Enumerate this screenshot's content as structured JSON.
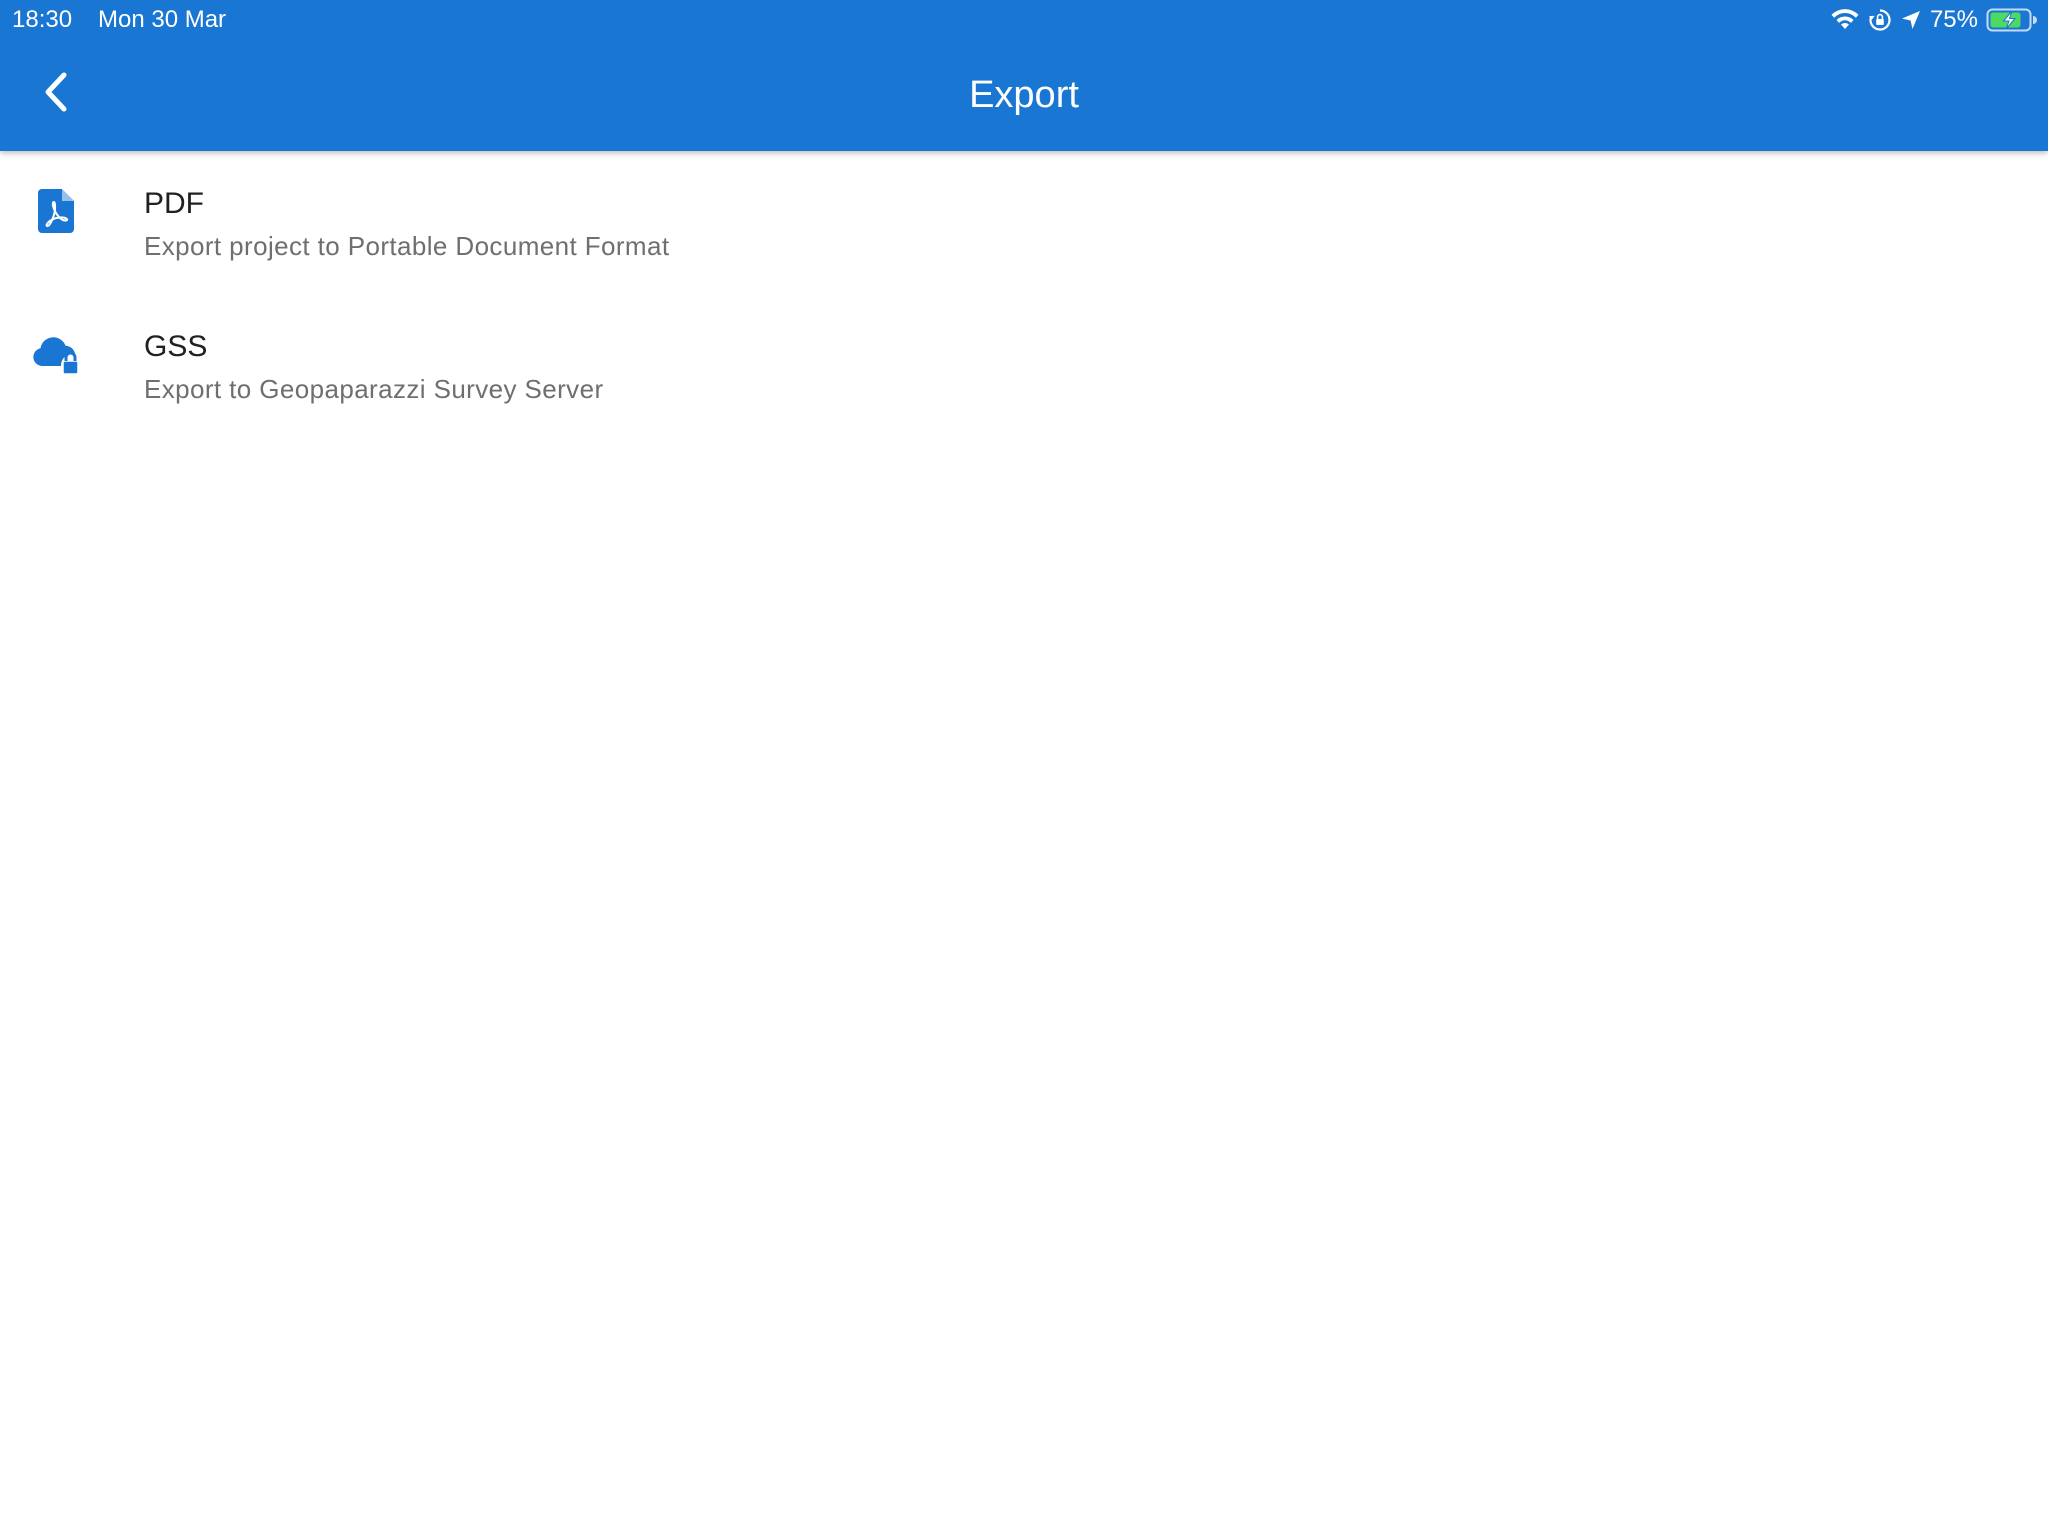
{
  "status_bar": {
    "time": "18:30",
    "date": "Mon 30 Mar",
    "battery": "75%",
    "icons": [
      "wifi-icon",
      "orientation-lock-icon",
      "location-arrow-icon",
      "battery-charging-icon"
    ]
  },
  "app_bar": {
    "title": "Export",
    "back_icon": "chevron-left-icon",
    "background_color": "#1976d2"
  },
  "export_options": [
    {
      "title": "PDF",
      "subtitle": "Export project to Portable Document Format",
      "icon": "pdf-file-icon"
    },
    {
      "title": "GSS",
      "subtitle": "Export to Geopaparazzi Survey Server",
      "icon": "cloud-lock-icon"
    }
  ],
  "colors": {
    "accent": "#1976d2",
    "title_text": "#212121",
    "subtitle_text": "#6f6f6f"
  }
}
